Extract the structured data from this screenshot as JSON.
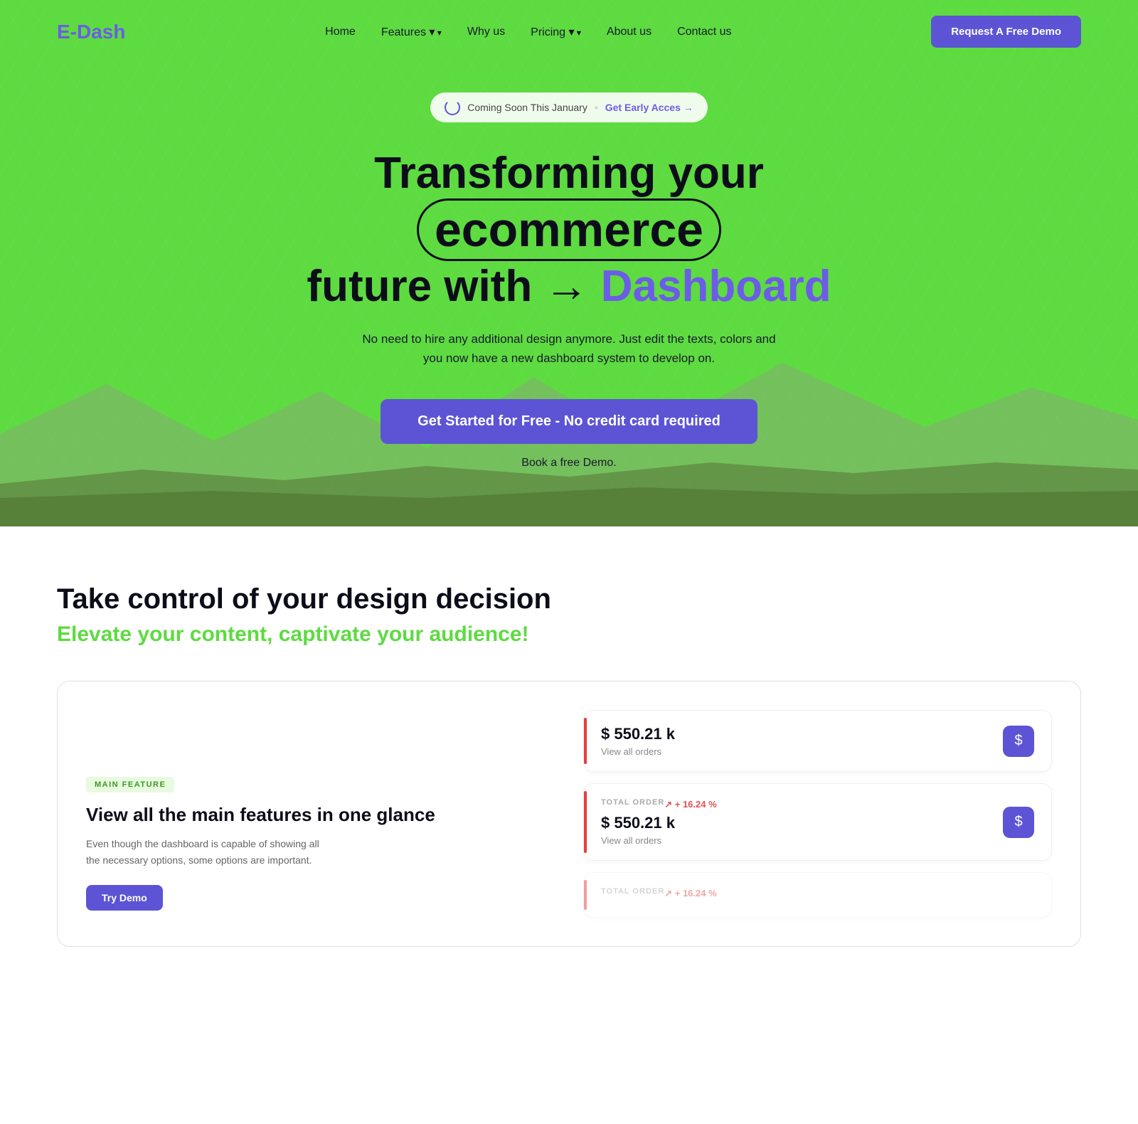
{
  "brand": {
    "name": "E-Dash"
  },
  "nav": {
    "links": [
      {
        "label": "Home",
        "has_dropdown": false
      },
      {
        "label": "Features",
        "has_dropdown": true
      },
      {
        "label": "Why us",
        "has_dropdown": false
      },
      {
        "label": "Pricing",
        "has_dropdown": true
      },
      {
        "label": "About us",
        "has_dropdown": false
      },
      {
        "label": "Contact us",
        "has_dropdown": false
      }
    ],
    "cta_label": "Request A Free Demo"
  },
  "hero": {
    "badge_text": "Coming Soon This January",
    "badge_dot": "•",
    "badge_link": "Get Early Acces →",
    "title_part1": "Transforming your",
    "title_highlight": "ecommerce",
    "title_part2": "future with",
    "title_arrow": "→",
    "title_dashboard": "Dashboard",
    "subtitle": "No need to hire any additional design anymore. Just edit the texts, colors and you now have a new dashboard system to develop on.",
    "cta_button": "Get Started for Free - No credit card required",
    "demo_text": "Book a free Demo."
  },
  "features": {
    "heading": "Take control of your design decision",
    "subheading": "Elevate your content, captivate your audience!",
    "feature_card": {
      "badge": "MAIN FEATURE",
      "title": "View all the main features in one glance",
      "description": "Even though the dashboard is capable of showing all the necessary options, some options are important.",
      "cta": "Try Demo"
    },
    "stats": [
      {
        "value": "$ 550.21 k",
        "label": "View all orders",
        "has_badge": false,
        "trend": null,
        "icon": "$"
      },
      {
        "badge_label": "TOTAL ORDER",
        "trend": "+ 16.24 %",
        "value": "$ 550.21 k",
        "label": "View all orders",
        "has_badge": true,
        "icon": "$"
      },
      {
        "badge_label": "TOTAL ORDER",
        "trend": "+ 16.24 %",
        "value": "",
        "label": "",
        "has_badge": true,
        "icon": "$",
        "faded": true
      }
    ]
  }
}
